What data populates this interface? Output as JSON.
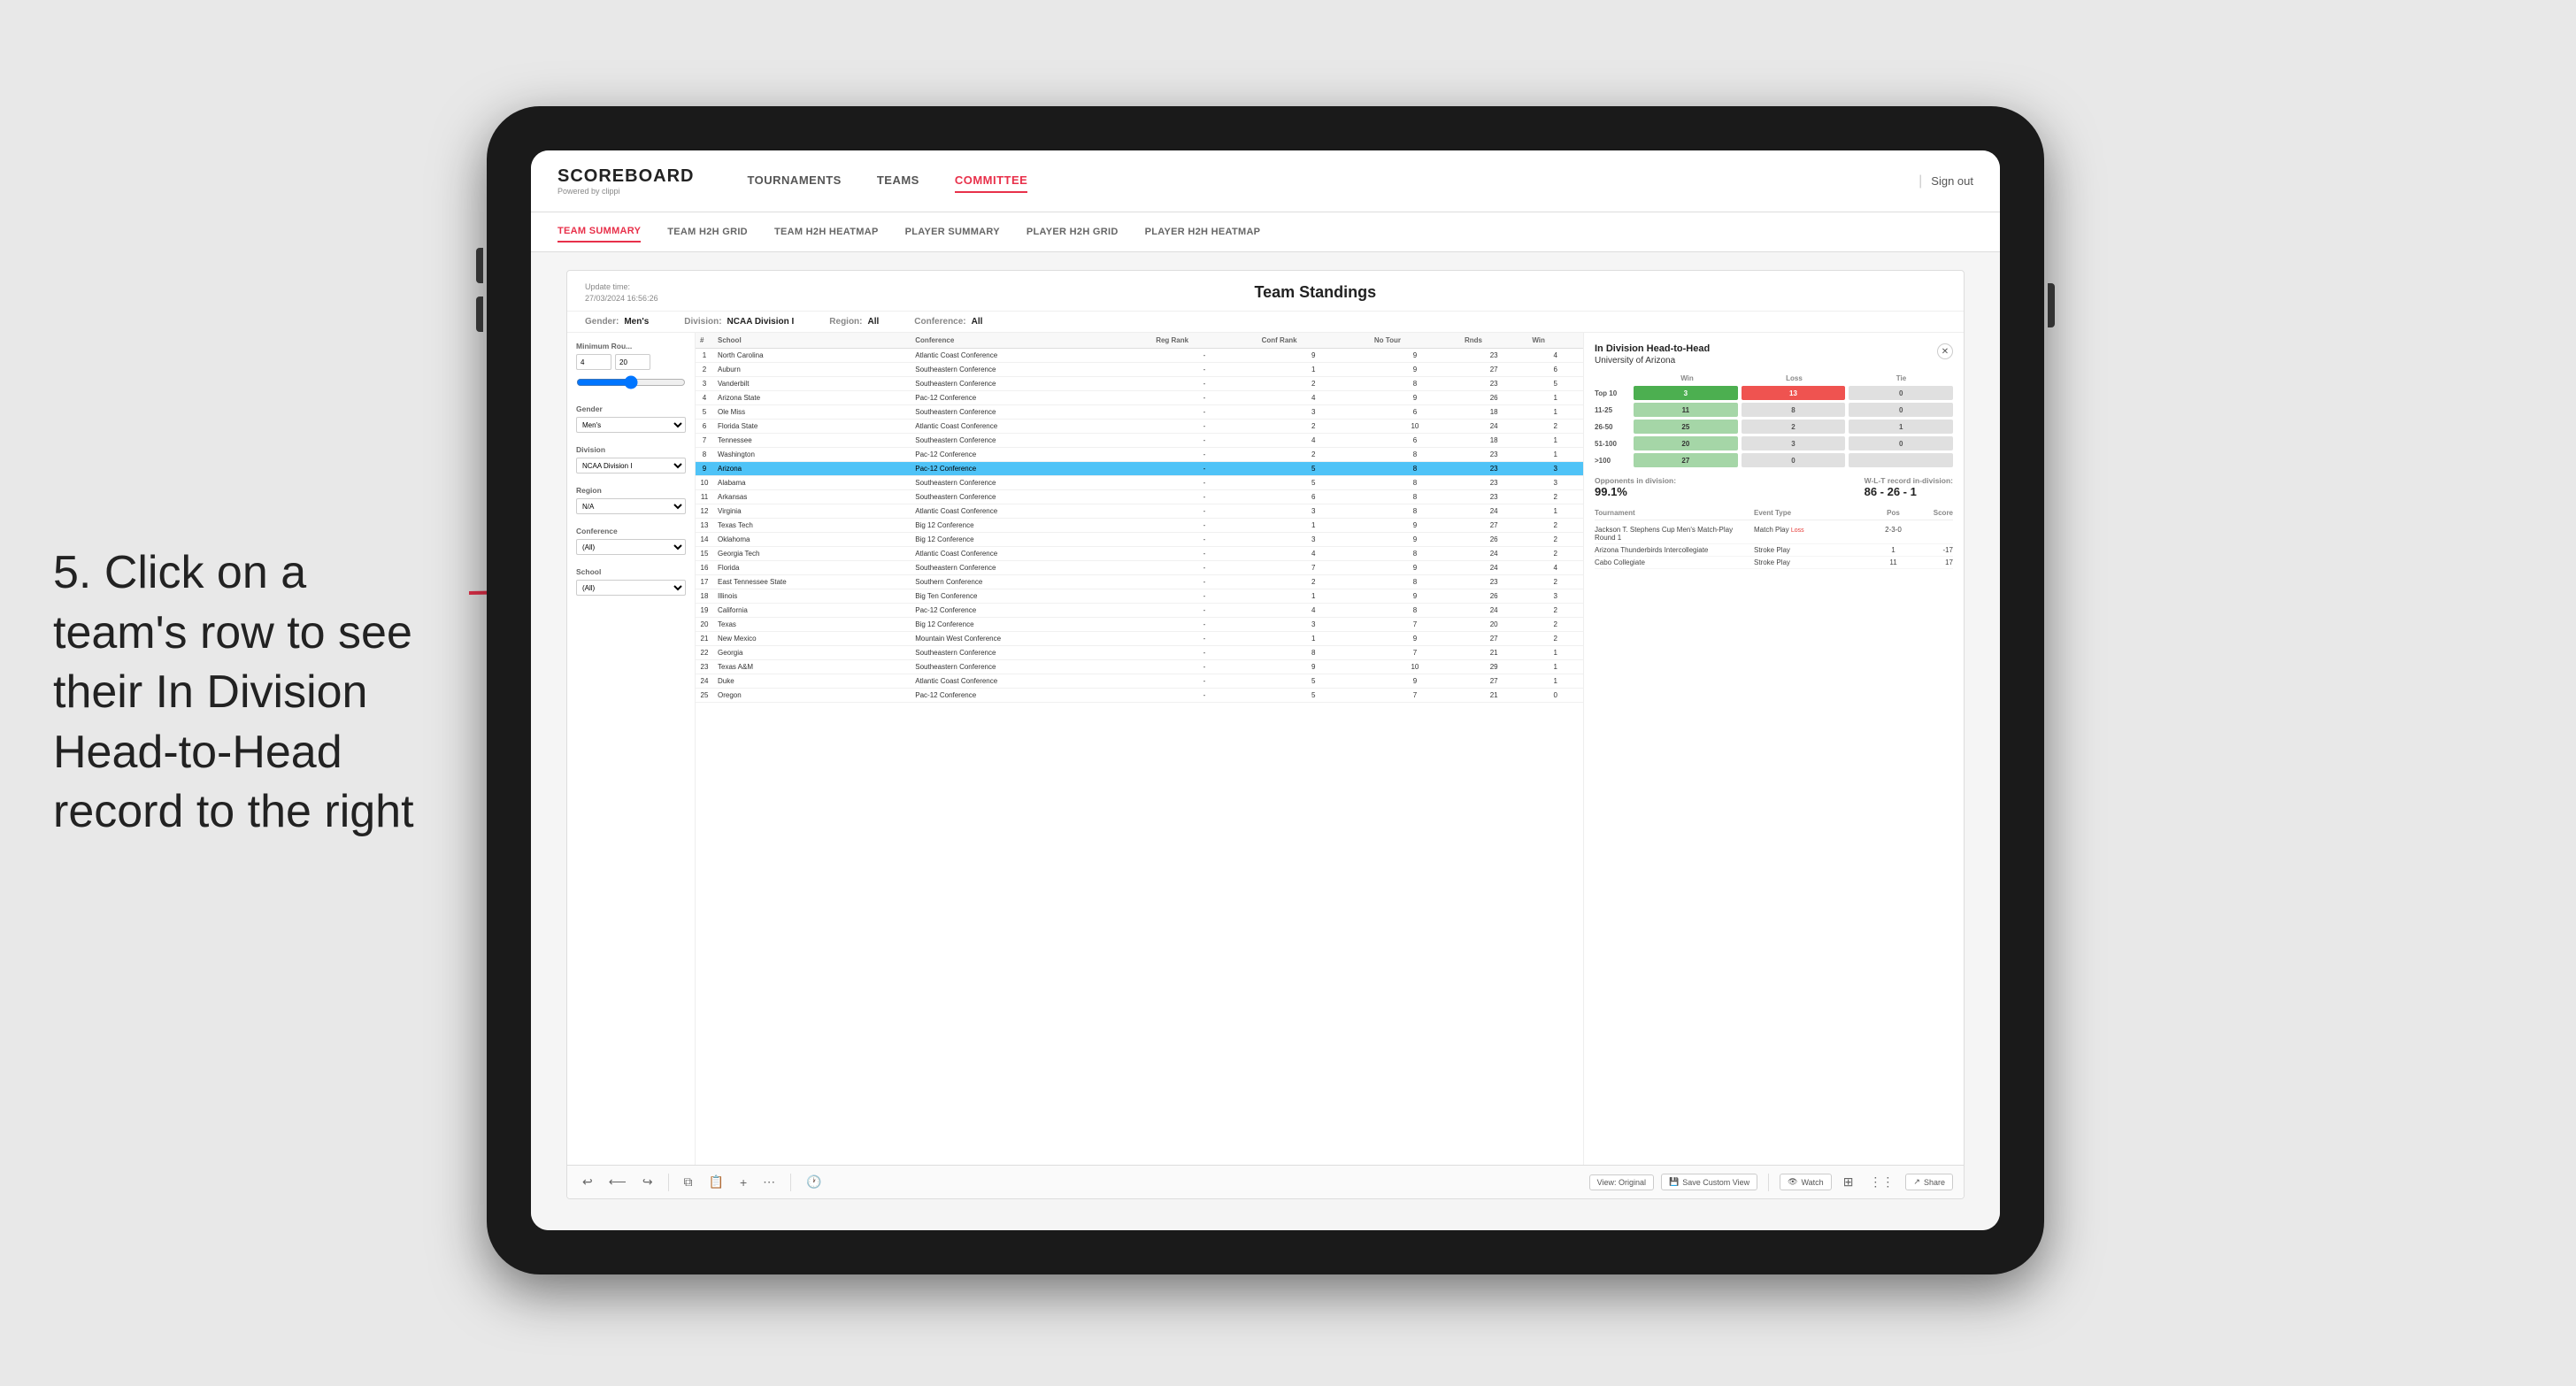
{
  "instruction": {
    "step": "5.",
    "line1": "Click on a",
    "line2": "team's row to see",
    "line3": "their In Division",
    "line4": "Head-to-Head",
    "line5": "record to the right"
  },
  "nav": {
    "logo": "SCOREBOARD",
    "logo_sub": "Powered by clippi",
    "links": [
      "TOURNAMENTS",
      "TEAMS",
      "COMMITTEE"
    ],
    "active_link": "COMMITTEE",
    "sign_out": "Sign out",
    "sub_links": [
      "TEAM SUMMARY",
      "TEAM H2H GRID",
      "TEAM H2H HEATMAP",
      "PLAYER SUMMARY",
      "PLAYER H2H GRID",
      "PLAYER H2H HEATMAP"
    ],
    "active_sub": "TEAM SUMMARY"
  },
  "panel": {
    "title": "Team Standings",
    "update_time_label": "Update time:",
    "update_time": "27/03/2024 16:56:26",
    "filters": {
      "gender_label": "Gender:",
      "gender_value": "Men's",
      "division_label": "Division:",
      "division_value": "NCAA Division I",
      "region_label": "Region:",
      "region_value": "All",
      "conference_label": "Conference:",
      "conference_value": "All"
    },
    "sidebar": {
      "min_rounds_label": "Minimum Rou...",
      "min_val": "4",
      "max_val": "20",
      "gender_label": "Gender",
      "gender_options": [
        "Men's"
      ],
      "division_label": "Division",
      "division_value": "NCAA Division I",
      "region_label": "Region",
      "region_value": "N/A",
      "conference_label": "Conference",
      "conference_value": "(All)",
      "school_label": "School",
      "school_value": "(All)"
    },
    "table": {
      "headers": [
        "#",
        "School",
        "Conference",
        "Reg Rank",
        "Conf Rank",
        "No Tour",
        "Rnds",
        "Win"
      ],
      "rows": [
        {
          "rank": "1",
          "school": "North Carolina",
          "conference": "Atlantic Coast Conference",
          "reg": "-",
          "conf": "9",
          "no_tour": "9",
          "rnds": "23",
          "win": "4"
        },
        {
          "rank": "2",
          "school": "Auburn",
          "conference": "Southeastern Conference",
          "reg": "-",
          "conf": "1",
          "no_tour": "9",
          "rnds": "27",
          "win": "6"
        },
        {
          "rank": "3",
          "school": "Vanderbilt",
          "conference": "Southeastern Conference",
          "reg": "-",
          "conf": "2",
          "no_tour": "8",
          "rnds": "23",
          "win": "5"
        },
        {
          "rank": "4",
          "school": "Arizona State",
          "conference": "Pac-12 Conference",
          "reg": "-",
          "conf": "4",
          "no_tour": "9",
          "rnds": "26",
          "win": "1"
        },
        {
          "rank": "5",
          "school": "Ole Miss",
          "conference": "Southeastern Conference",
          "reg": "-",
          "conf": "3",
          "no_tour": "6",
          "rnds": "18",
          "win": "1"
        },
        {
          "rank": "6",
          "school": "Florida State",
          "conference": "Atlantic Coast Conference",
          "reg": "-",
          "conf": "2",
          "no_tour": "10",
          "rnds": "24",
          "win": "2"
        },
        {
          "rank": "7",
          "school": "Tennessee",
          "conference": "Southeastern Conference",
          "reg": "-",
          "conf": "4",
          "no_tour": "6",
          "rnds": "18",
          "win": "1"
        },
        {
          "rank": "8",
          "school": "Washington",
          "conference": "Pac-12 Conference",
          "reg": "-",
          "conf": "2",
          "no_tour": "8",
          "rnds": "23",
          "win": "1"
        },
        {
          "rank": "9",
          "school": "Arizona",
          "conference": "Pac-12 Conference",
          "reg": "-",
          "conf": "5",
          "no_tour": "8",
          "rnds": "23",
          "win": "3",
          "highlighted": true
        },
        {
          "rank": "10",
          "school": "Alabama",
          "conference": "Southeastern Conference",
          "reg": "-",
          "conf": "5",
          "no_tour": "8",
          "rnds": "23",
          "win": "3"
        },
        {
          "rank": "11",
          "school": "Arkansas",
          "conference": "Southeastern Conference",
          "reg": "-",
          "conf": "6",
          "no_tour": "8",
          "rnds": "23",
          "win": "2"
        },
        {
          "rank": "12",
          "school": "Virginia",
          "conference": "Atlantic Coast Conference",
          "reg": "-",
          "conf": "3",
          "no_tour": "8",
          "rnds": "24",
          "win": "1"
        },
        {
          "rank": "13",
          "school": "Texas Tech",
          "conference": "Big 12 Conference",
          "reg": "-",
          "conf": "1",
          "no_tour": "9",
          "rnds": "27",
          "win": "2"
        },
        {
          "rank": "14",
          "school": "Oklahoma",
          "conference": "Big 12 Conference",
          "reg": "-",
          "conf": "3",
          "no_tour": "9",
          "rnds": "26",
          "win": "2"
        },
        {
          "rank": "15",
          "school": "Georgia Tech",
          "conference": "Atlantic Coast Conference",
          "reg": "-",
          "conf": "4",
          "no_tour": "8",
          "rnds": "24",
          "win": "2"
        },
        {
          "rank": "16",
          "school": "Florida",
          "conference": "Southeastern Conference",
          "reg": "-",
          "conf": "7",
          "no_tour": "9",
          "rnds": "24",
          "win": "4"
        },
        {
          "rank": "17",
          "school": "East Tennessee State",
          "conference": "Southern Conference",
          "reg": "-",
          "conf": "2",
          "no_tour": "8",
          "rnds": "23",
          "win": "2"
        },
        {
          "rank": "18",
          "school": "Illinois",
          "conference": "Big Ten Conference",
          "reg": "-",
          "conf": "1",
          "no_tour": "9",
          "rnds": "26",
          "win": "3"
        },
        {
          "rank": "19",
          "school": "California",
          "conference": "Pac-12 Conference",
          "reg": "-",
          "conf": "4",
          "no_tour": "8",
          "rnds": "24",
          "win": "2"
        },
        {
          "rank": "20",
          "school": "Texas",
          "conference": "Big 12 Conference",
          "reg": "-",
          "conf": "3",
          "no_tour": "7",
          "rnds": "20",
          "win": "2"
        },
        {
          "rank": "21",
          "school": "New Mexico",
          "conference": "Mountain West Conference",
          "reg": "-",
          "conf": "1",
          "no_tour": "9",
          "rnds": "27",
          "win": "2"
        },
        {
          "rank": "22",
          "school": "Georgia",
          "conference": "Southeastern Conference",
          "reg": "-",
          "conf": "8",
          "no_tour": "7",
          "rnds": "21",
          "win": "1"
        },
        {
          "rank": "23",
          "school": "Texas A&M",
          "conference": "Southeastern Conference",
          "reg": "-",
          "conf": "9",
          "no_tour": "10",
          "rnds": "29",
          "win": "1"
        },
        {
          "rank": "24",
          "school": "Duke",
          "conference": "Atlantic Coast Conference",
          "reg": "-",
          "conf": "5",
          "no_tour": "9",
          "rnds": "27",
          "win": "1"
        },
        {
          "rank": "25",
          "school": "Oregon",
          "conference": "Pac-12 Conference",
          "reg": "-",
          "conf": "5",
          "no_tour": "7",
          "rnds": "21",
          "win": "0"
        }
      ]
    },
    "h2h": {
      "title": "In Division Head-to-Head",
      "school": "University of Arizona",
      "headers": [
        "Win",
        "Loss",
        "Tie"
      ],
      "rows": [
        {
          "range": "Top 10",
          "win": "3",
          "loss": "13",
          "tie": "0",
          "win_color": "green",
          "loss_color": "red"
        },
        {
          "range": "11-25",
          "win": "11",
          "loss": "8",
          "tie": "0",
          "win_color": "green_light",
          "loss_color": "gray"
        },
        {
          "range": "26-50",
          "win": "25",
          "loss": "2",
          "tie": "1",
          "win_color": "green_light",
          "loss_color": "gray"
        },
        {
          "range": "51-100",
          "win": "20",
          "loss": "3",
          "tie": "0",
          "win_color": "green_light",
          "loss_color": "gray"
        },
        {
          "range": ">100",
          "win": "27",
          "loss": "0",
          "tie": "",
          "win_color": "green_light",
          "loss_color": "gray"
        }
      ],
      "opponents_label": "Opponents in division:",
      "opponents_value": "99.1%",
      "wlt_label": "W-L-T record in-division:",
      "wlt_value": "86 - 26 - 1",
      "tournament_header": "Tournament",
      "event_type_header": "Event Type",
      "pos_header": "Pos",
      "score_header": "Score",
      "tournaments": [
        {
          "name": "Jackson T. Stephens Cup Men's Match-Play Round 1",
          "event": "Match Play",
          "result": "Loss",
          "pos": "2-3-0"
        },
        {
          "name": "Arizona Thunderbirds Intercollegiate",
          "event": "Stroke Play",
          "pos": "1",
          "score": "-17"
        },
        {
          "name": "Cabo Collegiate",
          "event": "Stroke Play",
          "pos": "11",
          "score": "17"
        }
      ]
    },
    "toolbar": {
      "view_original": "View: Original",
      "save_custom": "Save Custom View",
      "watch": "Watch",
      "share": "Share"
    }
  }
}
